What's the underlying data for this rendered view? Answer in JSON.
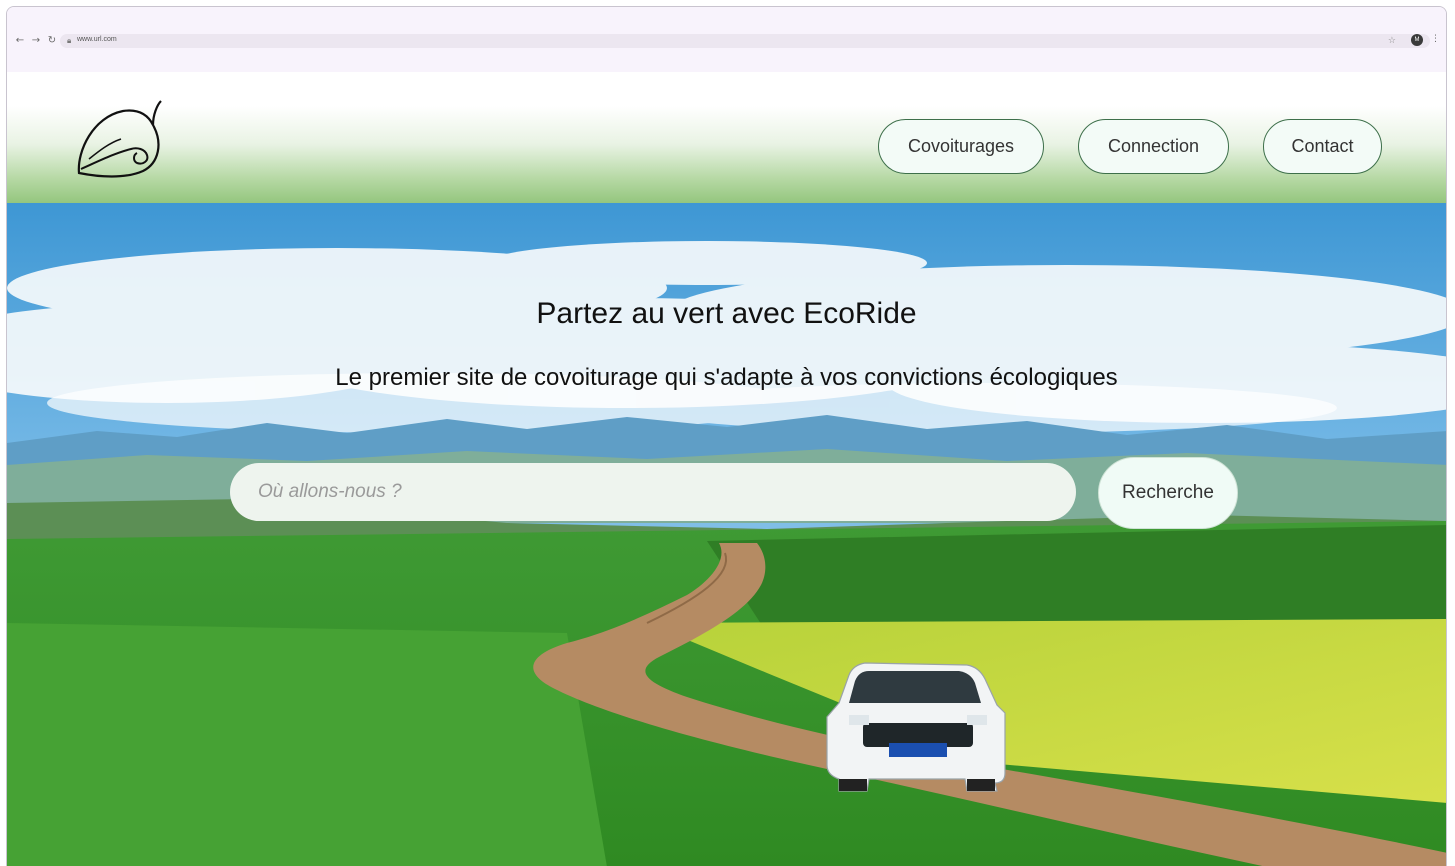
{
  "browser": {
    "back_icon": "back-arrow-icon",
    "forward_icon": "forward-arrow-icon",
    "reload_icon": "reload-icon",
    "url": "www.url.com",
    "profile_initial": "M"
  },
  "header": {
    "logo_icon": "leaf-logo-icon",
    "nav": {
      "covoiturages": "Covoiturages",
      "connection": "Connection",
      "contact": "Contact"
    }
  },
  "hero": {
    "title": "Partez au vert avec EcoRide",
    "subtitle": "Le premier site de covoiturage qui s'adapte à vos convictions écologiques",
    "search": {
      "placeholder": "Où allons-nous ?",
      "value": "",
      "button_label": "Recherche"
    }
  },
  "colors": {
    "header_gradient_bottom": "#94c67e",
    "button_border": "#3d6f4a",
    "button_bg": "#f3fbf7"
  }
}
